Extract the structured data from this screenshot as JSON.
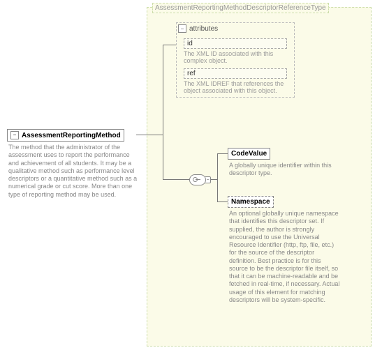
{
  "root": {
    "label": "AssessmentReportingMethod",
    "desc": "The method that the administrator of the assessment uses to report the performance and achievement of all students. It may be a qualitative method such as performance level descriptors or a quantitative method such as a numerical grade or cut score. More than one type of reporting method may be used."
  },
  "type": {
    "title": "AssessmentReportingMethodDescriptorReferenceType"
  },
  "attributes": {
    "heading": "attributes",
    "items": [
      {
        "name": "id",
        "desc": "The XML ID associated with this complex object."
      },
      {
        "name": "ref",
        "desc": "The XML IDREF that references the object associated with this object."
      }
    ]
  },
  "children": [
    {
      "name": "CodeValue",
      "desc": "A globally unique identifier within this descriptor type.",
      "optional": false
    },
    {
      "name": "Namespace",
      "desc": "An optional globally unique namespace that identifies this descriptor set. If supplied, the author is strongly encouraged to use the Universal Resource Identifier (http, ftp, file, etc.) for the source of the descriptor definition. Best practice is for this source to be the descriptor file itself, so that it can be machine-readable and be fetched in real-time, if necessary. Actual usage of this element for matching descriptors will be system-specific.",
      "optional": true
    }
  ],
  "glyphs": {
    "minus": "−",
    "plus": "+"
  }
}
